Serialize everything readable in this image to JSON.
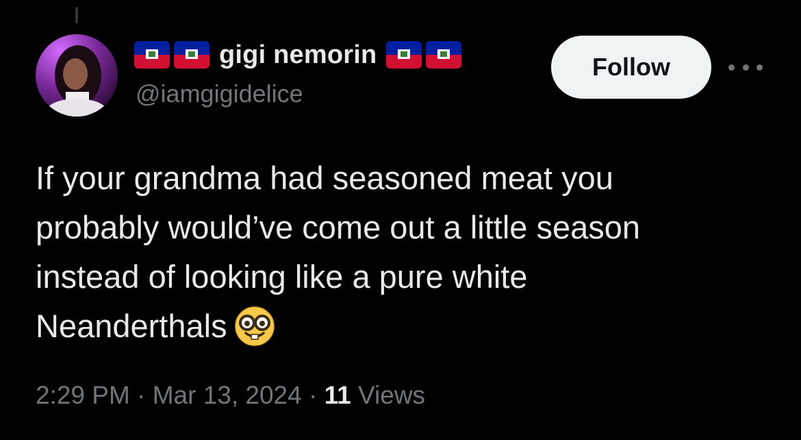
{
  "author": {
    "display_name": "gigi nemorin",
    "handle": "@iamgigidelice",
    "avatar_alt": "profile photo",
    "name_flags": [
      "haiti-flag",
      "haiti-flag",
      "haiti-flag",
      "haiti-flag"
    ]
  },
  "actions": {
    "follow_label": "Follow",
    "more_icon": "more-horizontal-icon"
  },
  "tweet": {
    "lines": [
      "If your grandma had seasoned meat you",
      "probably would’ve come out a little season",
      "instead of looking like a pure white",
      "Neanderthals"
    ],
    "trailing_emoji": "nerd-face-emoji"
  },
  "meta": {
    "time": "2:29 PM",
    "date": "Mar 13, 2024",
    "separator": "·",
    "views_count": "11",
    "views_label": "Views"
  },
  "colors": {
    "background": "#000000",
    "text": "#e7e9ea",
    "secondary": "#71767b",
    "button_bg": "#eff3f4",
    "flag_blue": "#00209f",
    "flag_red": "#d21034"
  }
}
